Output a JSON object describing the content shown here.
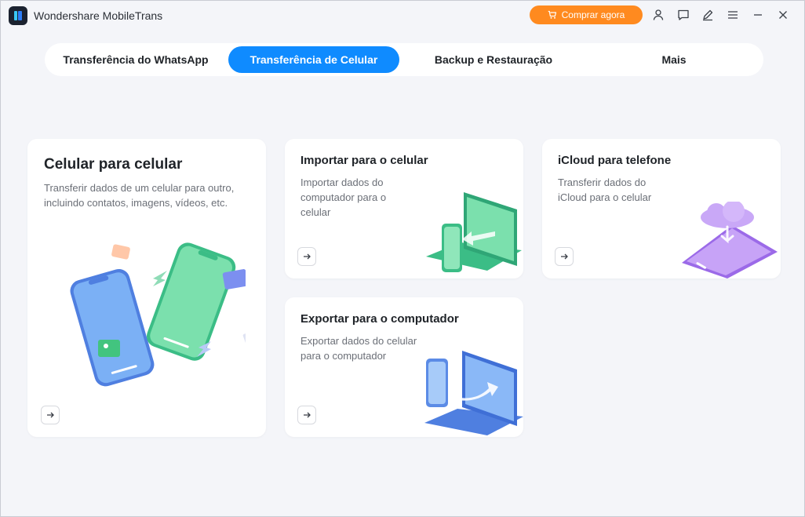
{
  "app": {
    "title": "Wondershare MobileTrans",
    "buy_label": "Comprar agora",
    "accent_color": "#ff8a1f"
  },
  "titlebar_icons": [
    "user-icon",
    "feedback-icon",
    "edit-icon",
    "menu-icon",
    "minimize-icon",
    "close-icon"
  ],
  "tabs": [
    {
      "label": "Transferência do WhatsApp",
      "active": false
    },
    {
      "label": "Transferência de Celular",
      "active": true
    },
    {
      "label": "Backup e Restauração",
      "active": false
    },
    {
      "label": "Mais",
      "active": false
    }
  ],
  "cards": {
    "phone_to_phone": {
      "title": "Celular para celular",
      "desc": "Transferir dados de um celular para outro, incluindo contatos, imagens, vídeos, etc."
    },
    "import": {
      "title": "Importar para o celular",
      "desc": "Importar dados do computador para o celular"
    },
    "icloud": {
      "title": "iCloud para telefone",
      "desc": "Transferir dados do iCloud para o celular"
    },
    "export": {
      "title": "Exportar para o computador",
      "desc": "Exportar dados do celular para o computador"
    }
  },
  "colors": {
    "tab_active": "#0f8bff",
    "background": "#f4f5f9"
  }
}
